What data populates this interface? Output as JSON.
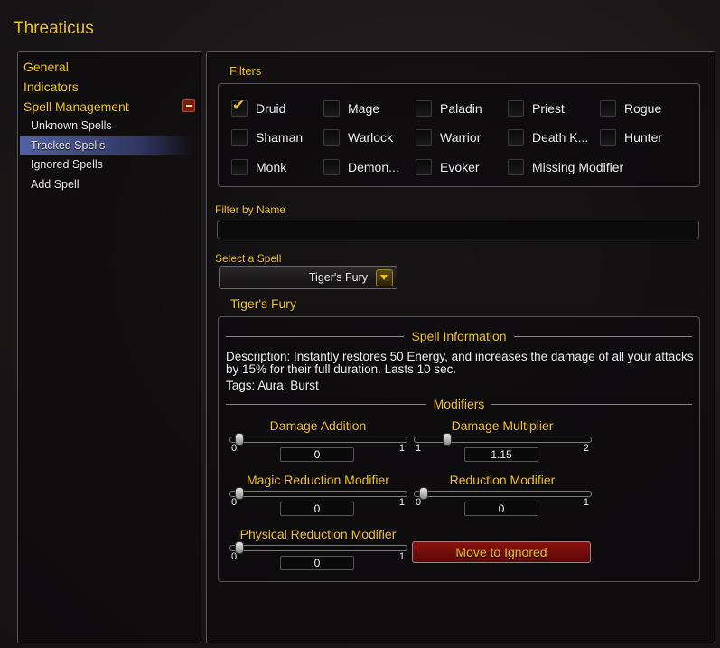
{
  "app": {
    "title": "Threaticus"
  },
  "sidebar": {
    "top_items": [
      {
        "label": "General"
      },
      {
        "label": "Indicators"
      },
      {
        "label": "Spell Management"
      }
    ],
    "sub_items": [
      {
        "label": "Unknown Spells"
      },
      {
        "label": "Tracked Spells",
        "selected": true
      },
      {
        "label": "Ignored Spells"
      },
      {
        "label": "Add Spell"
      }
    ],
    "highlight_color": "#5f70be"
  },
  "filters": {
    "title": "Filters",
    "classes": [
      {
        "label": "Druid",
        "checked": true
      },
      {
        "label": "Mage",
        "checked": false
      },
      {
        "label": "Paladin",
        "checked": false
      },
      {
        "label": "Priest",
        "checked": false
      },
      {
        "label": "Rogue",
        "checked": false
      },
      {
        "label": "Shaman",
        "checked": false
      },
      {
        "label": "Warlock",
        "checked": false
      },
      {
        "label": "Warrior",
        "checked": false
      },
      {
        "label": "Death K...",
        "checked": false
      },
      {
        "label": "Hunter",
        "checked": false
      },
      {
        "label": "Monk",
        "checked": false
      },
      {
        "label": "Demon...",
        "checked": false
      },
      {
        "label": "Evoker",
        "checked": false
      },
      {
        "label": "Missing Modifier",
        "checked": false
      }
    ]
  },
  "name_filter": {
    "label": "Filter by Name",
    "value": "",
    "placeholder": ""
  },
  "spell_select": {
    "label": "Select a Spell",
    "value": "Tiger's Fury"
  },
  "spell": {
    "heading": "Tiger's Fury",
    "info_header": "Spell Information",
    "description": "Description: Instantly restores 50 Energy, and increases the damage of all your attacks by 15% for their full duration. Lasts 10 sec.",
    "tags": "Tags: Aura, Burst",
    "modifiers_header": "Modifiers"
  },
  "modifiers": {
    "damage_addition": {
      "label": "Damage Addition",
      "min": "0",
      "max": "1",
      "value": "0",
      "fraction": 0
    },
    "damage_multiplier": {
      "label": "Damage Multiplier",
      "min": "1",
      "max": "2",
      "value": "1.15",
      "fraction": 0.15
    },
    "magic_reduction": {
      "label": "Magic Reduction Modifier",
      "min": "0",
      "max": "1",
      "value": "0",
      "fraction": 0
    },
    "reduction": {
      "label": "Reduction Modifier",
      "min": "0",
      "max": "1",
      "value": "0",
      "fraction": 0
    },
    "physical_reduction": {
      "label": "Physical Reduction Modifier",
      "min": "0",
      "max": "1",
      "value": "0",
      "fraction": 0
    }
  },
  "actions": {
    "move_to_ignored": "Move to Ignored"
  },
  "colors": {
    "accent_gold": "#f2c40a",
    "button_red": "#8a120f",
    "panel_border": "#5a5a5a"
  }
}
